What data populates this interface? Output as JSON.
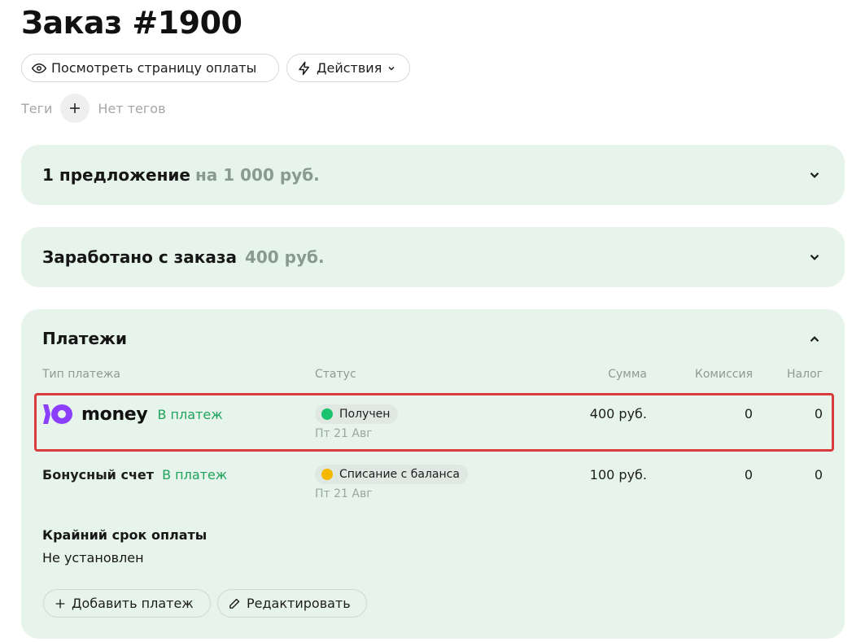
{
  "page": {
    "title": "Заказ #1900"
  },
  "toolbar": {
    "view_payment_page": "Посмотреть страницу оплаты",
    "actions": "Действия"
  },
  "tags": {
    "label": "Теги",
    "empty": "Нет тегов"
  },
  "offers": {
    "title": "1 предложение",
    "amount": "на 1 000 руб."
  },
  "earned": {
    "title": "Заработано с заказа",
    "amount": "400 руб."
  },
  "payments": {
    "title": "Платежи",
    "columns": {
      "type": "Тип платежа",
      "status": "Статус",
      "sum": "Сумма",
      "commission": "Комиссия",
      "tax": "Налог"
    },
    "rows": [
      {
        "type_logo": "money",
        "link": "В платеж",
        "status": "Получен",
        "status_color": "#1cc36e",
        "date": "Пт 21 Авг",
        "sum": "400 руб.",
        "commission": "0",
        "tax": "0"
      },
      {
        "type": "Бонусный счет",
        "link": "В платеж",
        "status": "Списание с баланса",
        "status_color": "#f5b800",
        "date": "Пт 21 Авг",
        "sum": "100 руб.",
        "commission": "0",
        "tax": "0"
      }
    ],
    "deadline_label": "Крайний срок оплаты",
    "deadline_value": "Не установлен",
    "add_payment": "Добавить платеж",
    "edit": "Редактировать"
  },
  "colors": {
    "card_bg": "#e6f4ec",
    "accent_green": "#1fa35c",
    "highlight": "#d93c3c"
  }
}
